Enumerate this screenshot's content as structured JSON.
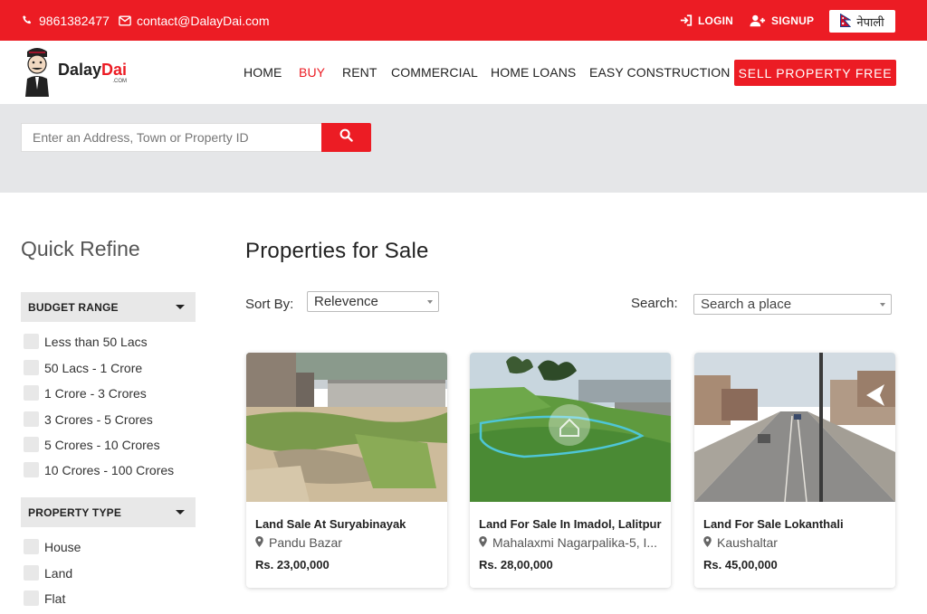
{
  "topbar": {
    "phone": "9861382477",
    "email": "contact@DalayDai.com",
    "login": "LOGIN",
    "signup": "SIGNUP",
    "language": "नेपाली",
    "icons": [
      "phone-icon",
      "mail-icon",
      "login-icon",
      "user-plus-icon",
      "nepal-flag-icon"
    ]
  },
  "brand": {
    "name_part1": "Dalay",
    "name_part2": "Dai",
    "domain": ".COM"
  },
  "nav": {
    "items": [
      "HOME",
      "BUY",
      "RENT",
      "COMMERCIAL",
      "HOME LOANS",
      "EASY CONSTRUCTION"
    ],
    "active": "BUY",
    "sell_button": "SELL PROPERTY FREE"
  },
  "search": {
    "placeholder": "Enter an Address, Town or Property ID",
    "button_icon": "search-icon"
  },
  "sidebar": {
    "title": "Quick Refine",
    "budget": {
      "heading": "BUDGET RANGE",
      "options": [
        "Less than 50 Lacs",
        "50 Lacs - 1 Crore",
        "1 Crore - 3 Crores",
        "3 Crores - 5 Crores",
        "5 Crores - 10 Crores",
        "10 Crores - 100 Crores"
      ]
    },
    "property_type": {
      "heading": "PROPERTY TYPE",
      "options": [
        "House",
        "Land",
        "Flat"
      ]
    }
  },
  "main": {
    "title": "Properties for Sale",
    "sort_label": "Sort By:",
    "sort_value": "Relevence",
    "search_label": "Search:",
    "search_placeholder": "Search a place"
  },
  "listings": [
    {
      "title": "Land Sale At Suryabinayak",
      "location": "Pandu Bazar",
      "price": "Rs. 23,00,000"
    },
    {
      "title": "Land For Sale In Imadol, Lalitpur",
      "location": "Mahalaxmi Nagarpalika-5, I...",
      "price": "Rs. 28,00,000"
    },
    {
      "title": "Land For Sale Lokanthali",
      "location": "Kaushaltar",
      "price": "Rs. 45,00,000"
    }
  ],
  "colors": {
    "brand_red": "#ec1c24",
    "band_gray": "#e5e6e8"
  }
}
